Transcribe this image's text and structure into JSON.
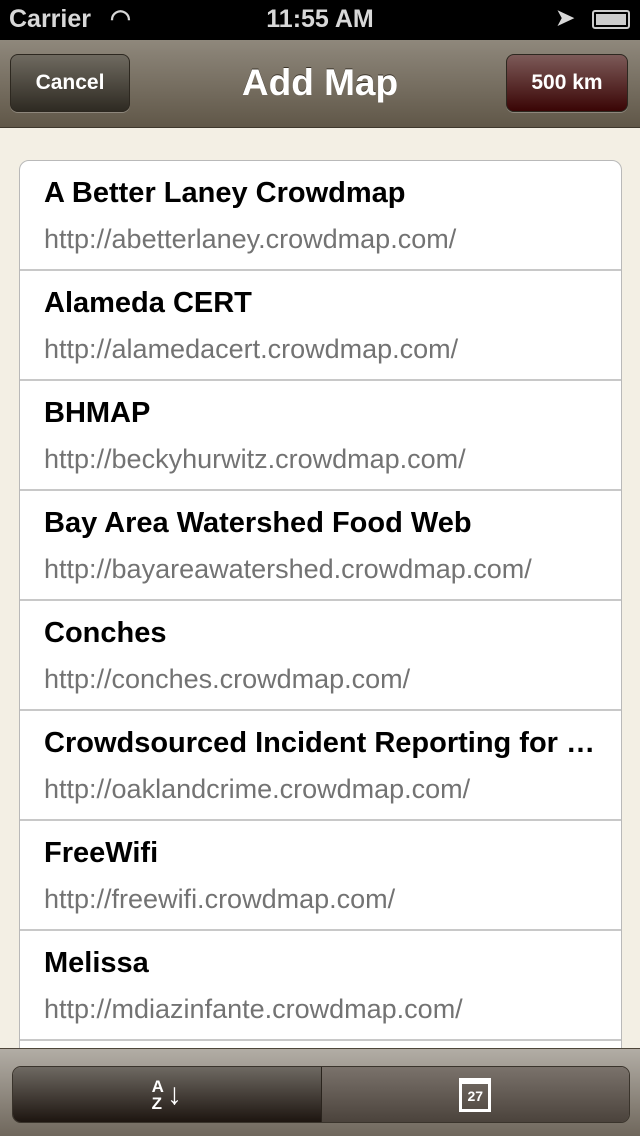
{
  "status": {
    "carrier": "Carrier",
    "time": "11:55 AM"
  },
  "nav": {
    "cancel": "Cancel",
    "title": "Add Map",
    "distance": "500 km"
  },
  "maps": [
    {
      "name": "A Better Laney Crowdmap",
      "url": "http://abetterlaney.crowdmap.com/"
    },
    {
      "name": "Alameda CERT",
      "url": "http://alamedacert.crowdmap.com/"
    },
    {
      "name": "BHMAP",
      "url": "http://beckyhurwitz.crowdmap.com/"
    },
    {
      "name": "Bay Area Watershed Food Web",
      "url": "http://bayareawatershed.crowdmap.com/"
    },
    {
      "name": "Conches",
      "url": "http://conches.crowdmap.com/"
    },
    {
      "name": "Crowdsourced Incident Reporting for Oakland",
      "url": "http://oaklandcrime.crowdmap.com/"
    },
    {
      "name": "FreeWifi",
      "url": "http://freewifi.crowdmap.com/"
    },
    {
      "name": "Melissa",
      "url": "http://mdiazinfante.crowdmap.com/"
    }
  ],
  "toolbar": {
    "sort_alpha": {
      "top": "A",
      "bottom": "Z",
      "icon": "sort-alphabetical-icon",
      "selected": true
    },
    "sort_date": {
      "day": "27",
      "icon": "calendar-icon",
      "selected": false
    }
  }
}
